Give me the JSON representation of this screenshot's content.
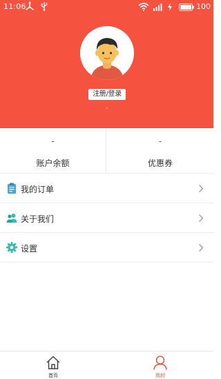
{
  "status_bar": {
    "time": "11:06",
    "battery_percent": "100",
    "icons": [
      "usb-debug-icon",
      "usb-icon",
      "wifi-icon",
      "signal-icon",
      "charging-icon",
      "battery-icon"
    ]
  },
  "profile": {
    "avatar_icon": "avatar-icon",
    "login_label": "注册/登录",
    "username": "-"
  },
  "stats": {
    "balance": {
      "value": "-",
      "label": "账户余额"
    },
    "coupon": {
      "value": "-",
      "label": "优惠券"
    }
  },
  "menu": {
    "items": [
      {
        "label": "我的订单",
        "icon": "clipboard-icon"
      },
      {
        "label": "关于我们",
        "icon": "users-icon"
      },
      {
        "label": "设置",
        "icon": "gear-icon"
      }
    ]
  },
  "tabbar": {
    "home_label": "首页",
    "mine_label": "我的"
  },
  "colors": {
    "brand": "#f65240",
    "menu_icon_blue": "#4aa3dd",
    "menu_icon_teal": "#3bbcb0"
  }
}
